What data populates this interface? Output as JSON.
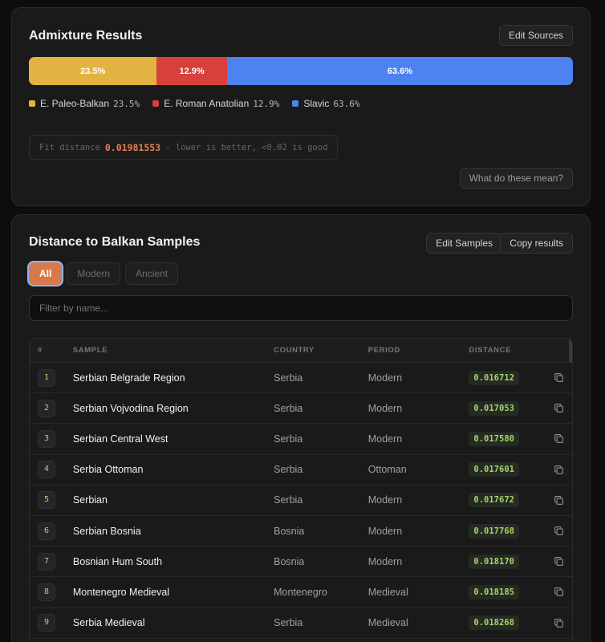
{
  "admixture": {
    "title": "Admixture Results",
    "edit_label": "Edit Sources",
    "segments": [
      {
        "label": "23.5%",
        "value": 23.5,
        "color": "#e3b341"
      },
      {
        "label": "12.9%",
        "value": 12.9,
        "color": "#d6413b"
      },
      {
        "label": "63.6%",
        "value": 63.6,
        "color": "#4d82f0"
      }
    ],
    "legend": [
      {
        "name": "E. Paleo-Balkan",
        "value": "23.5%",
        "color": "#e3b341"
      },
      {
        "name": "E. Roman Anatolian",
        "value": "12.9%",
        "color": "#d6413b"
      },
      {
        "name": "Slavic",
        "value": "63.6%",
        "color": "#4d82f0"
      }
    ],
    "fit_prefix": "Fit distance",
    "fit_value": "0.01981553",
    "fit_suffix": "- lower is better, <0.02 is good",
    "help_label": "What do these mean?"
  },
  "distance": {
    "title": "Distance to Balkan Samples",
    "edit_label": "Edit Samples",
    "copy_label": "Copy results",
    "tabs": [
      "All",
      "Modern",
      "Ancient"
    ],
    "active_tab": "All",
    "filter_placeholder": "Filter by name...",
    "filter_value": "",
    "columns": [
      "#",
      "SAMPLE",
      "COUNTRY",
      "PERIOD",
      "DISTANCE"
    ],
    "rows": [
      {
        "num": "1",
        "sample": "Serbian Belgrade Region",
        "country": "Serbia",
        "period": "Modern",
        "distance": "0.016712"
      },
      {
        "num": "2",
        "sample": "Serbian Vojvodina Region",
        "country": "Serbia",
        "period": "Modern",
        "distance": "0.017053"
      },
      {
        "num": "3",
        "sample": "Serbian Central West",
        "country": "Serbia",
        "period": "Modern",
        "distance": "0.017580"
      },
      {
        "num": "4",
        "sample": "Serbia Ottoman",
        "country": "Serbia",
        "period": "Ottoman",
        "distance": "0.017601"
      },
      {
        "num": "5",
        "sample": "Serbian",
        "country": "Serbia",
        "period": "Modern",
        "distance": "0.017672"
      },
      {
        "num": "6",
        "sample": "Serbian Bosnia",
        "country": "Bosnia",
        "period": "Modern",
        "distance": "0.017768"
      },
      {
        "num": "7",
        "sample": "Bosnian Hum South",
        "country": "Bosnia",
        "period": "Modern",
        "distance": "0.018170"
      },
      {
        "num": "8",
        "sample": "Montenegro Medieval",
        "country": "Montenegro",
        "period": "Medieval",
        "distance": "0.018185"
      },
      {
        "num": "9",
        "sample": "Serbia Medieval",
        "country": "Serbia",
        "period": "Medieval",
        "distance": "0.018268"
      }
    ]
  },
  "icons": {
    "copy": "copy-icon"
  }
}
